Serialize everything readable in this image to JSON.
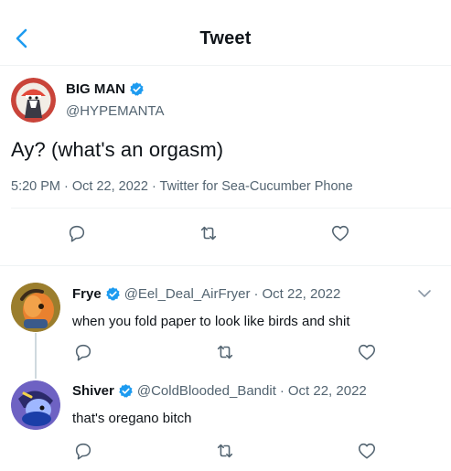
{
  "header": {
    "title": "Tweet",
    "back_icon": "chevron-left-icon"
  },
  "main_tweet": {
    "display_name": "BIG MAN",
    "handle": "@HYPEMANTA",
    "text": "Ay? (what's an orgasm)",
    "meta": "5:20 PM · Oct 22, 2022 · Twitter for Sea-Cucumber Phone",
    "verified": true,
    "actions": [
      "reply-icon",
      "retweet-icon",
      "like-icon"
    ]
  },
  "replies": [
    {
      "display_name": "Frye",
      "handle": "@Eel_Deal_AirFryer",
      "separator": "·",
      "date": "Oct 22, 2022",
      "text": "when you fold paper to look like birds and shit",
      "verified": true
    },
    {
      "display_name": "Shiver",
      "handle": "@ColdBlooded_Bandit",
      "separator": "·",
      "date": "Oct 22, 2022",
      "text": "that's oregano bitch",
      "verified": true
    }
  ],
  "colors": {
    "accent": "#1d9bf0",
    "text_primary": "#0f1419",
    "text_secondary": "#536471",
    "border": "#eff3f4"
  }
}
